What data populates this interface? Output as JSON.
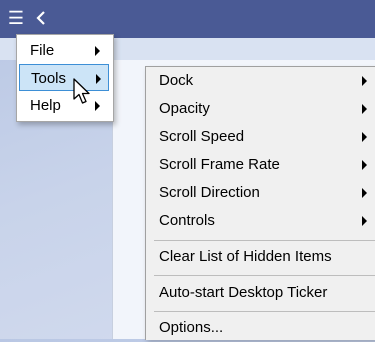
{
  "titlebar": {
    "menu_glyph": "☰",
    "menu_icon": "hamburger-icon",
    "back_icon": "chevron-left-icon",
    "color": "#4a5a95"
  },
  "main_menu": {
    "items": [
      {
        "label": "File",
        "has_submenu": true,
        "selected": false
      },
      {
        "label": "Tools",
        "has_submenu": true,
        "selected": true
      },
      {
        "label": "Help",
        "has_submenu": true,
        "selected": false
      }
    ],
    "selected_color": "#cce4f7",
    "selected_border": "#3d8fd6"
  },
  "tools_submenu": {
    "items": [
      {
        "label": "Dock",
        "has_submenu": true
      },
      {
        "label": "Opacity",
        "has_submenu": true
      },
      {
        "label": "Scroll Speed",
        "has_submenu": true
      },
      {
        "label": "Scroll Frame Rate",
        "has_submenu": true
      },
      {
        "label": "Scroll Direction",
        "has_submenu": true
      },
      {
        "label": "Controls",
        "has_submenu": true
      },
      {
        "label": "Clear List of Hidden Items",
        "has_submenu": false
      },
      {
        "label": "Auto-start Desktop Ticker",
        "has_submenu": false
      },
      {
        "label": "Options...",
        "has_submenu": false
      }
    ]
  },
  "cursor": {
    "icon": "arrow-cursor-icon"
  }
}
